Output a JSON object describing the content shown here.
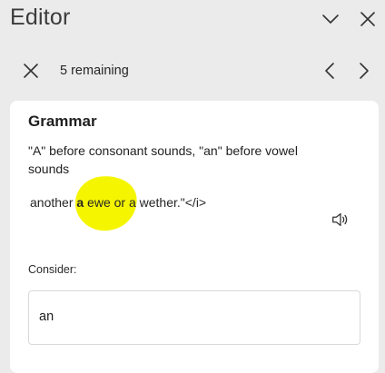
{
  "pane": {
    "title": "Editor",
    "collapse_icon": "chevron-down-icon",
    "close_icon": "close-icon"
  },
  "nav": {
    "dismiss_icon": "close-icon",
    "remaining_text": "5 remaining",
    "prev_icon": "chevron-left-icon",
    "next_icon": "chevron-right-icon"
  },
  "card": {
    "heading": "Grammar",
    "description": "\"A\" before consonant sounds, \"an\" before vowel sounds",
    "context_before": "another ",
    "context_flagged": "a",
    "context_after": " ewe or a wether.\"</i>",
    "speaker_icon": "speaker-icon",
    "highlight_color": "#f5f500",
    "consider_label": "Consider:",
    "suggestion": "an"
  }
}
